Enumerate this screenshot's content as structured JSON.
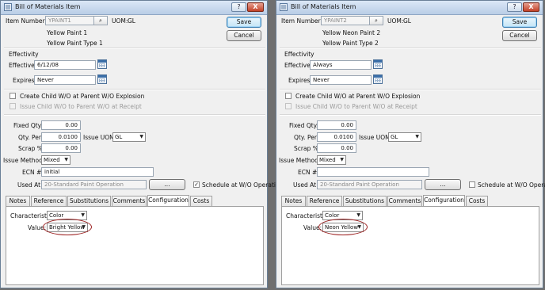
{
  "windows": [
    {
      "title": "Bill of Materials Item",
      "help_label": "?",
      "close_label": "X",
      "item_number_label": "Item Number:",
      "item_number": "YPAINT1",
      "lookup_icon": "⌕",
      "uom_label": "UOM:",
      "uom": "GL",
      "description1": "Yellow Paint 1",
      "description2": "Yellow Paint Type 1",
      "save_label": "Save",
      "cancel_label": "Cancel",
      "effectivity_title": "Effectivity",
      "effective_label": "Effective",
      "effective_value": "6/12/08",
      "expires_label": "Expires",
      "expires_value": "Never",
      "create_child_label": "Create Child W/O at Parent W/O Explosion",
      "issue_child_label": "Issue Child W/O to Parent W/O at Receipt",
      "fixed_qty_label": "Fixed Qty.:",
      "fixed_qty": "0.00",
      "qty_per_label": "Qty. Per:",
      "qty_per": "0.0100",
      "issue_uom_label": "Issue UOM:",
      "issue_uom": "GL",
      "scrap_label": "Scrap %:",
      "scrap": "0.00",
      "issue_method_label": "Issue Method:",
      "issue_method": "Mixed",
      "ecn_label": "ECN #:",
      "ecn": "initial",
      "used_at_label": "Used At:",
      "used_at": "20-Standard Paint Operation",
      "used_at_button": "...",
      "schedule_label": "Schedule at W/O Operation",
      "schedule_checked": true,
      "tabs": [
        "Notes",
        "Reference",
        "Substitutions",
        "Comments",
        "Configuration",
        "Costs"
      ],
      "active_tab": "Configuration",
      "characteristic_label": "Characteristic:",
      "characteristic": "Color",
      "value_label": "Value:",
      "value": "Bright Yellow"
    },
    {
      "title": "Bill of Materials Item",
      "help_label": "?",
      "close_label": "X",
      "item_number_label": "Item Number:",
      "item_number": "YPAINT2",
      "lookup_icon": "⌕",
      "uom_label": "UOM:",
      "uom": "GL",
      "description1": "Yellow Neon Paint 2",
      "description2": "Yellow Paint Type 2",
      "save_label": "Save",
      "cancel_label": "Cancel",
      "effectivity_title": "Effectivity",
      "effective_label": "Effective",
      "effective_value": "Always",
      "expires_label": "Expires",
      "expires_value": "Never",
      "create_child_label": "Create Child W/O at Parent W/O Explosion",
      "issue_child_label": "Issue Child W/O to Parent W/O at Receipt",
      "fixed_qty_label": "Fixed Qty.:",
      "fixed_qty": "0.00",
      "qty_per_label": "Qty. Per:",
      "qty_per": "0.0100",
      "issue_uom_label": "Issue UOM:",
      "issue_uom": "GL",
      "scrap_label": "Scrap %:",
      "scrap": "0.00",
      "issue_method_label": "Issue Method:",
      "issue_method": "Mixed",
      "ecn_label": "ECN #:",
      "ecn": "",
      "used_at_label": "Used At:",
      "used_at": "20-Standard Paint Operation",
      "used_at_button": "...",
      "schedule_label": "Schedule at W/O Operation",
      "schedule_checked": false,
      "tabs": [
        "Notes",
        "Reference",
        "Substitutions",
        "Comments",
        "Configuration",
        "Costs"
      ],
      "active_tab": "Configuration",
      "characteristic_label": "Characteristic:",
      "characteristic": "Color",
      "value_label": "Value:",
      "value": "Neon Yellow"
    }
  ],
  "colors": {
    "highlight_ellipse": "#9c2020",
    "titlebar": "#c6d7ec"
  }
}
